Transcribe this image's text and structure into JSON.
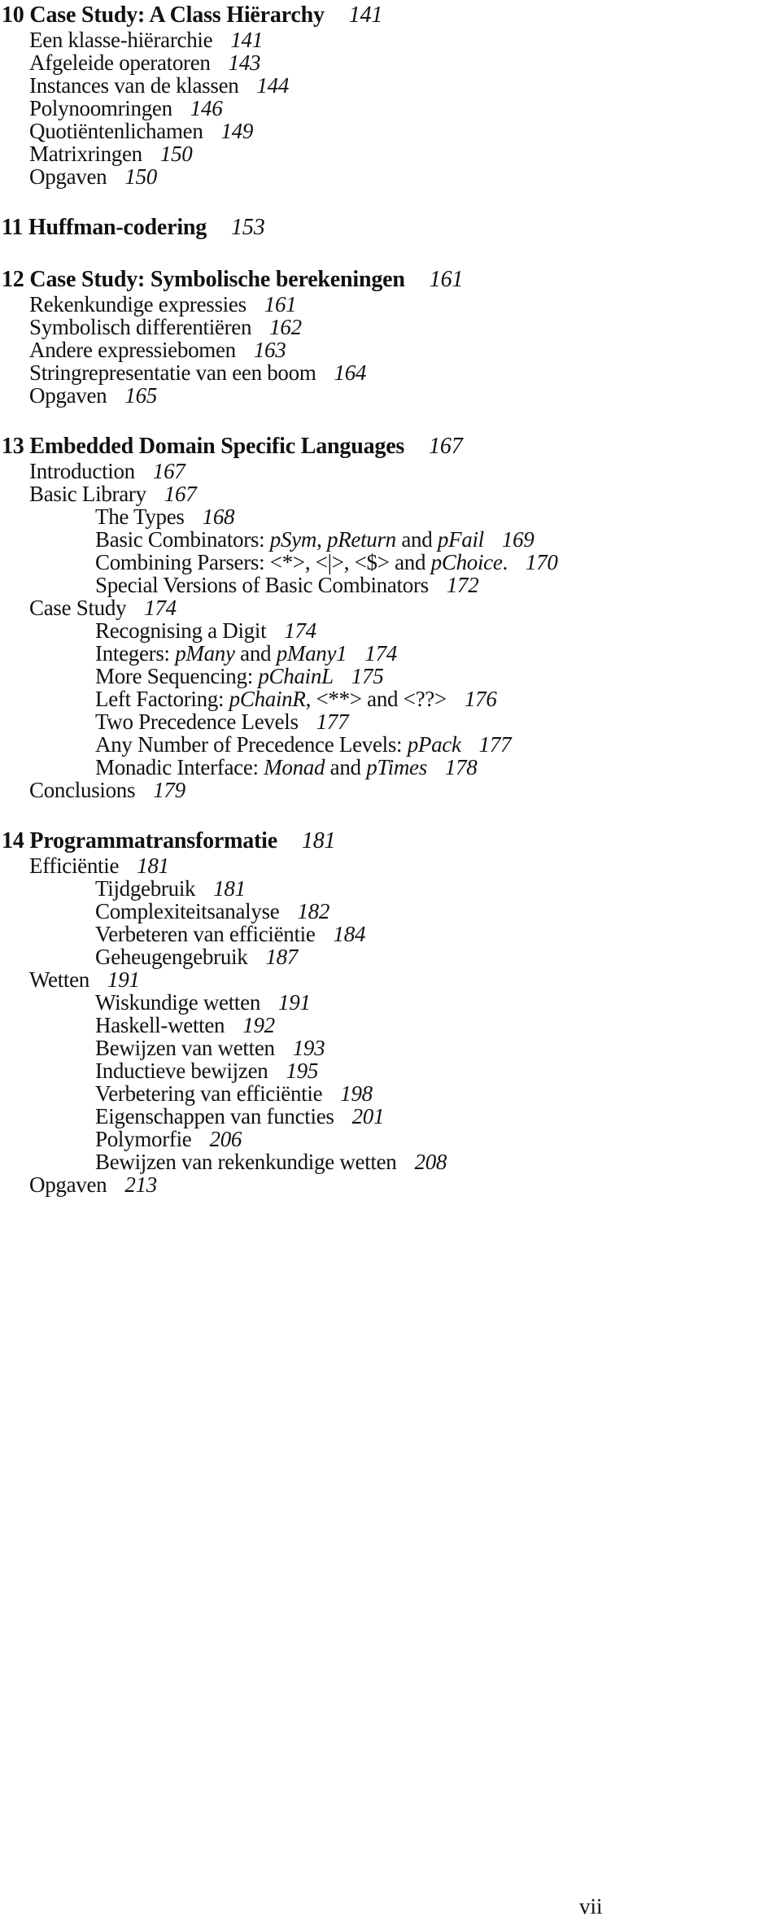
{
  "chapters": [
    {
      "number": "10",
      "title": "Case Study: A Class Hiërarchy",
      "page": "141",
      "entries": [
        {
          "level": 1,
          "parts": [
            {
              "t": "Een klasse-hiërarchie"
            }
          ],
          "page": "141"
        },
        {
          "level": 1,
          "parts": [
            {
              "t": "Afgeleide operatoren"
            }
          ],
          "page": "143"
        },
        {
          "level": 1,
          "parts": [
            {
              "t": "Instances van de klassen"
            }
          ],
          "page": "144"
        },
        {
          "level": 1,
          "parts": [
            {
              "t": "Polynoomringen"
            }
          ],
          "page": "146"
        },
        {
          "level": 1,
          "parts": [
            {
              "t": "Quotiëntenlichamen"
            }
          ],
          "page": "149"
        },
        {
          "level": 1,
          "parts": [
            {
              "t": "Matrixringen"
            }
          ],
          "page": "150"
        },
        {
          "level": 1,
          "parts": [
            {
              "t": "Opgaven"
            }
          ],
          "page": "150"
        }
      ]
    },
    {
      "number": "11",
      "title": "Huffman-codering",
      "page": "153",
      "entries": []
    },
    {
      "number": "12",
      "title": "Case Study: Symbolische berekeningen",
      "page": "161",
      "entries": [
        {
          "level": 1,
          "parts": [
            {
              "t": "Rekenkundige expressies"
            }
          ],
          "page": "161"
        },
        {
          "level": 1,
          "parts": [
            {
              "t": "Symbolisch differentiëren"
            }
          ],
          "page": "162"
        },
        {
          "level": 1,
          "parts": [
            {
              "t": "Andere expressiebomen"
            }
          ],
          "page": "163"
        },
        {
          "level": 1,
          "parts": [
            {
              "t": "Stringrepresentatie van een boom"
            }
          ],
          "page": "164"
        },
        {
          "level": 1,
          "parts": [
            {
              "t": "Opgaven"
            }
          ],
          "page": "165"
        }
      ]
    },
    {
      "number": "13",
      "title": "Embedded Domain Specific Languages",
      "page": "167",
      "entries": [
        {
          "level": 1,
          "parts": [
            {
              "t": "Introduction"
            }
          ],
          "page": "167"
        },
        {
          "level": 1,
          "parts": [
            {
              "t": "Basic Library"
            }
          ],
          "page": "167"
        },
        {
          "level": 2,
          "parts": [
            {
              "t": "The Types"
            }
          ],
          "page": "168"
        },
        {
          "level": 2,
          "parts": [
            {
              "t": "Basic Combinators: "
            },
            {
              "t": "pSym",
              "i": true
            },
            {
              "t": ", "
            },
            {
              "t": "pReturn",
              "i": true
            },
            {
              "t": " and "
            },
            {
              "t": "pFail",
              "i": true
            }
          ],
          "page": "169"
        },
        {
          "level": 2,
          "parts": [
            {
              "t": "Combining Parsers: <*>, <|>, <$> and "
            },
            {
              "t": "pChoice",
              "i": true
            },
            {
              "t": "."
            }
          ],
          "page": "170"
        },
        {
          "level": 2,
          "parts": [
            {
              "t": "Special Versions of Basic Combinators"
            }
          ],
          "page": "172"
        },
        {
          "level": 1,
          "parts": [
            {
              "t": "Case Study"
            }
          ],
          "page": "174"
        },
        {
          "level": 2,
          "parts": [
            {
              "t": "Recognising a Digit"
            }
          ],
          "page": "174"
        },
        {
          "level": 2,
          "parts": [
            {
              "t": "Integers: "
            },
            {
              "t": "pMany",
              "i": true
            },
            {
              "t": " and "
            },
            {
              "t": "pMany1",
              "i": true
            }
          ],
          "page": "174"
        },
        {
          "level": 2,
          "parts": [
            {
              "t": "More Sequencing: "
            },
            {
              "t": "pChainL",
              "i": true
            }
          ],
          "page": "175"
        },
        {
          "level": 2,
          "parts": [
            {
              "t": "Left Factoring: "
            },
            {
              "t": "pChainR",
              "i": true
            },
            {
              "t": ", <**> and <??>"
            }
          ],
          "page": "176"
        },
        {
          "level": 2,
          "parts": [
            {
              "t": "Two Precedence Levels"
            }
          ],
          "page": "177"
        },
        {
          "level": 2,
          "parts": [
            {
              "t": "Any Number of Precedence Levels: "
            },
            {
              "t": "pPack",
              "i": true
            }
          ],
          "page": "177"
        },
        {
          "level": 2,
          "parts": [
            {
              "t": "Monadic Interface: "
            },
            {
              "t": "Monad",
              "i": true
            },
            {
              "t": " and "
            },
            {
              "t": "pTimes",
              "i": true
            }
          ],
          "page": "178"
        },
        {
          "level": 1,
          "parts": [
            {
              "t": "Conclusions"
            }
          ],
          "page": "179"
        }
      ]
    },
    {
      "number": "14",
      "title": "Programmatransformatie",
      "page": "181",
      "entries": [
        {
          "level": 1,
          "parts": [
            {
              "t": "Efficiëntie"
            }
          ],
          "page": "181"
        },
        {
          "level": 2,
          "parts": [
            {
              "t": "Tijdgebruik"
            }
          ],
          "page": "181"
        },
        {
          "level": 2,
          "parts": [
            {
              "t": "Complexiteitsanalyse"
            }
          ],
          "page": "182"
        },
        {
          "level": 2,
          "parts": [
            {
              "t": "Verbeteren van efficiëntie"
            }
          ],
          "page": "184"
        },
        {
          "level": 2,
          "parts": [
            {
              "t": "Geheugengebruik"
            }
          ],
          "page": "187"
        },
        {
          "level": 1,
          "parts": [
            {
              "t": "Wetten"
            }
          ],
          "page": "191"
        },
        {
          "level": 2,
          "parts": [
            {
              "t": "Wiskundige wetten"
            }
          ],
          "page": "191"
        },
        {
          "level": 2,
          "parts": [
            {
              "t": "Haskell-wetten"
            }
          ],
          "page": "192"
        },
        {
          "level": 2,
          "parts": [
            {
              "t": "Bewijzen van wetten"
            }
          ],
          "page": "193"
        },
        {
          "level": 2,
          "parts": [
            {
              "t": "Inductieve bewijzen"
            }
          ],
          "page": "195"
        },
        {
          "level": 2,
          "parts": [
            {
              "t": "Verbetering van efficiëntie"
            }
          ],
          "page": "198"
        },
        {
          "level": 2,
          "parts": [
            {
              "t": "Eigenschappen van functies"
            }
          ],
          "page": "201"
        },
        {
          "level": 2,
          "parts": [
            {
              "t": "Polymorfie"
            }
          ],
          "page": "206"
        },
        {
          "level": 2,
          "parts": [
            {
              "t": "Bewijzen van rekenkundige wetten"
            }
          ],
          "page": "208"
        },
        {
          "level": 1,
          "parts": [
            {
              "t": "Opgaven"
            }
          ],
          "page": "213"
        }
      ]
    }
  ],
  "footer": {
    "page_number": "vii"
  }
}
